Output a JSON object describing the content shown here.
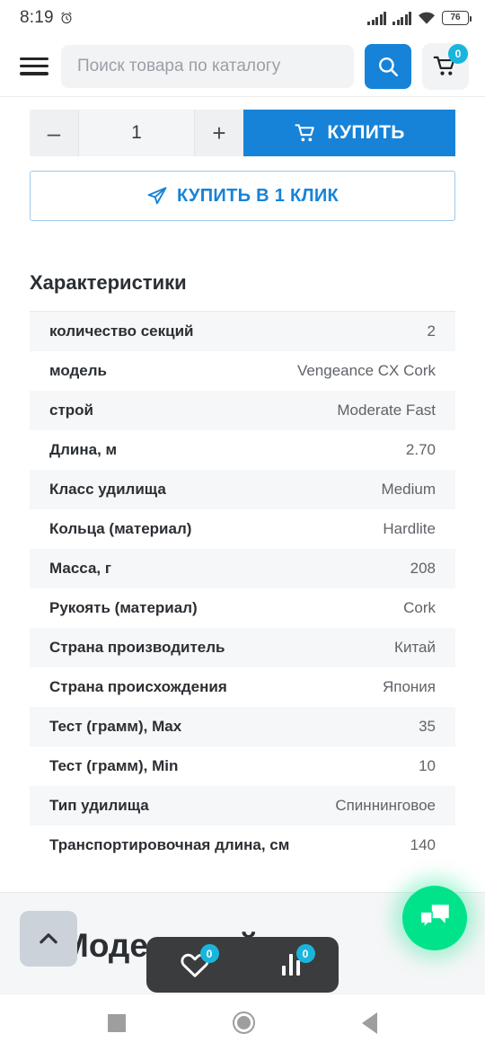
{
  "statusbar": {
    "time": "8:19",
    "battery": "76"
  },
  "header": {
    "search_placeholder": "Поиск товара по каталогу",
    "cart_count": "0"
  },
  "purchase": {
    "quantity": "1",
    "decrease_label": "–",
    "increase_label": "+",
    "buy_label": "КУПИТЬ",
    "one_click_label": "КУПИТЬ В 1 КЛИК"
  },
  "specs": {
    "title": "Характеристики",
    "rows": [
      {
        "key": "количество секций",
        "value": "2"
      },
      {
        "key": "модель",
        "value": "Vengeance CX Cork"
      },
      {
        "key": "строй",
        "value": "Moderate Fast"
      },
      {
        "key": "Длина, м",
        "value": "2.70"
      },
      {
        "key": "Класс удилища",
        "value": "Medium"
      },
      {
        "key": "Кольца (материал)",
        "value": "Hardlite"
      },
      {
        "key": "Масса, г",
        "value": "208"
      },
      {
        "key": "Рукоять (материал)",
        "value": "Cork"
      },
      {
        "key": "Страна производитель",
        "value": "Китай"
      },
      {
        "key": "Страна происхождения",
        "value": "Япония"
      },
      {
        "key": "Тест (грамм), Max",
        "value": "35"
      },
      {
        "key": "Тест (грамм), Min",
        "value": "10"
      },
      {
        "key": "Тип удилища",
        "value": "Спиннинговое"
      },
      {
        "key": "Транспортировочная длина, см",
        "value": "140"
      }
    ]
  },
  "bottom": {
    "next_section_title": "Модельный ряд",
    "favorites_count": "0",
    "compare_count": "0"
  },
  "colors": {
    "accent_blue": "#1683d8",
    "badge_cyan": "#19b5dd",
    "chat_green": "#00e38a",
    "row_alt": "#f5f7f9"
  }
}
